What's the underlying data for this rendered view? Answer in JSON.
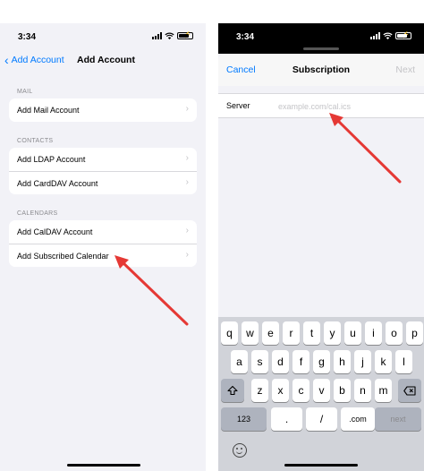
{
  "left": {
    "status_time": "3:34",
    "back_label": "Add Account",
    "title": "Add Account",
    "sections": [
      {
        "header": "MAIL",
        "items": [
          {
            "label": "Add Mail Account"
          }
        ]
      },
      {
        "header": "CONTACTS",
        "items": [
          {
            "label": "Add LDAP Account"
          },
          {
            "label": "Add CardDAV Account"
          }
        ]
      },
      {
        "header": "CALENDARS",
        "items": [
          {
            "label": "Add CalDAV Account"
          },
          {
            "label": "Add Subscribed Calendar"
          }
        ]
      }
    ]
  },
  "right": {
    "status_time": "3:34",
    "cancel_label": "Cancel",
    "title": "Subscription",
    "next_label": "Next",
    "server_label": "Server",
    "server_placeholder": "example.com/cal.ics",
    "server_value": "",
    "keyboard": {
      "row1": [
        "q",
        "w",
        "e",
        "r",
        "t",
        "y",
        "u",
        "i",
        "o",
        "p"
      ],
      "row2": [
        "a",
        "s",
        "d",
        "f",
        "g",
        "h",
        "j",
        "k",
        "l"
      ],
      "row3": [
        "z",
        "x",
        "c",
        "v",
        "b",
        "n",
        "m"
      ],
      "shift_icon": "shift-icon",
      "delete_icon": "delete-icon",
      "numbers_label": "123",
      "slash_label": "/",
      "dot_label": ".",
      "dotcom_label": ".com",
      "next_label": "next",
      "emoji_icon": "emoji-icon"
    }
  },
  "colors": {
    "accent": "#007aff",
    "annotation_arrow": "#e53935",
    "grouped_bg": "#f2f2f7",
    "keyboard_bg": "#d1d3d9"
  }
}
